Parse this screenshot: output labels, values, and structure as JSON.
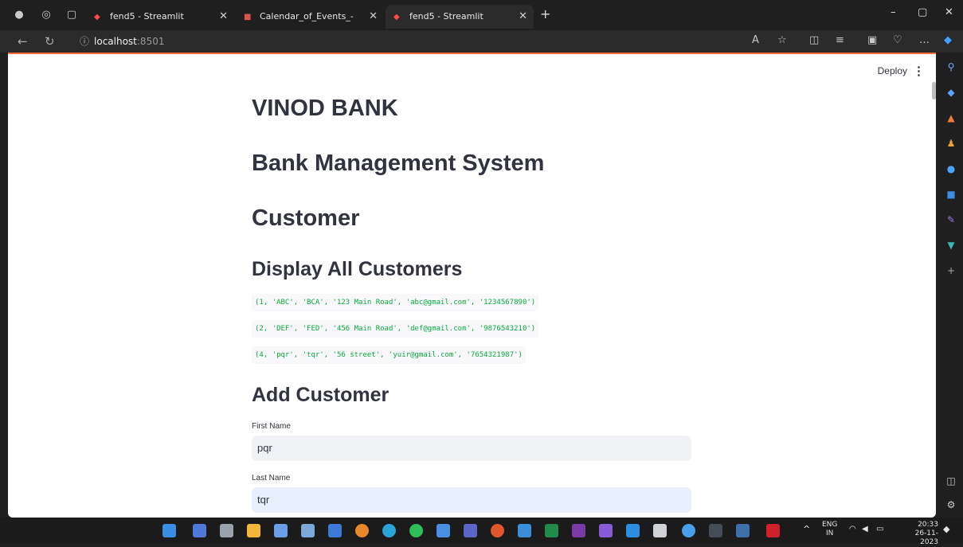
{
  "browser": {
    "tabs": [
      {
        "title": "fend5 - Streamlit",
        "active": false
      },
      {
        "title": "Calendar_of_Events_-UG_Program",
        "active": false
      },
      {
        "title": "fend5 - Streamlit",
        "active": true
      }
    ],
    "address": {
      "host": "localhost",
      "port": ":8501"
    }
  },
  "header": {
    "deploy_label": "Deploy",
    "menu_icon": "more-vertical-icon"
  },
  "app": {
    "title": "VINOD BANK",
    "subtitle": "Bank Management System",
    "section": "Customer",
    "display_heading": "Display All Customers",
    "customers": [
      "(1, 'ABC', 'BCA', '123 Main Road', 'abc@gmail.com', '1234567890')",
      "(2, 'DEF', 'FED', '456 Main Road', 'def@gmail.com', '9876543210')",
      "(4, 'pqr', 'tqr', '56 street', 'yuir@gmail.com', '7654321987')"
    ],
    "add_heading": "Add Customer",
    "form": {
      "first_name_label": "First Name",
      "first_name_value": "pqr",
      "last_name_label": "Last Name",
      "last_name_value": "tqr"
    }
  },
  "taskbar": {
    "language": "ENG",
    "region": "IN",
    "time": "20:33",
    "date": "26-11-2023"
  },
  "colors": {
    "code_text": "#09ab3b",
    "accent_bar": "#ff6f3c",
    "field_bg": "#f0f2f6",
    "field_focus_bg": "#e8f0fe"
  }
}
